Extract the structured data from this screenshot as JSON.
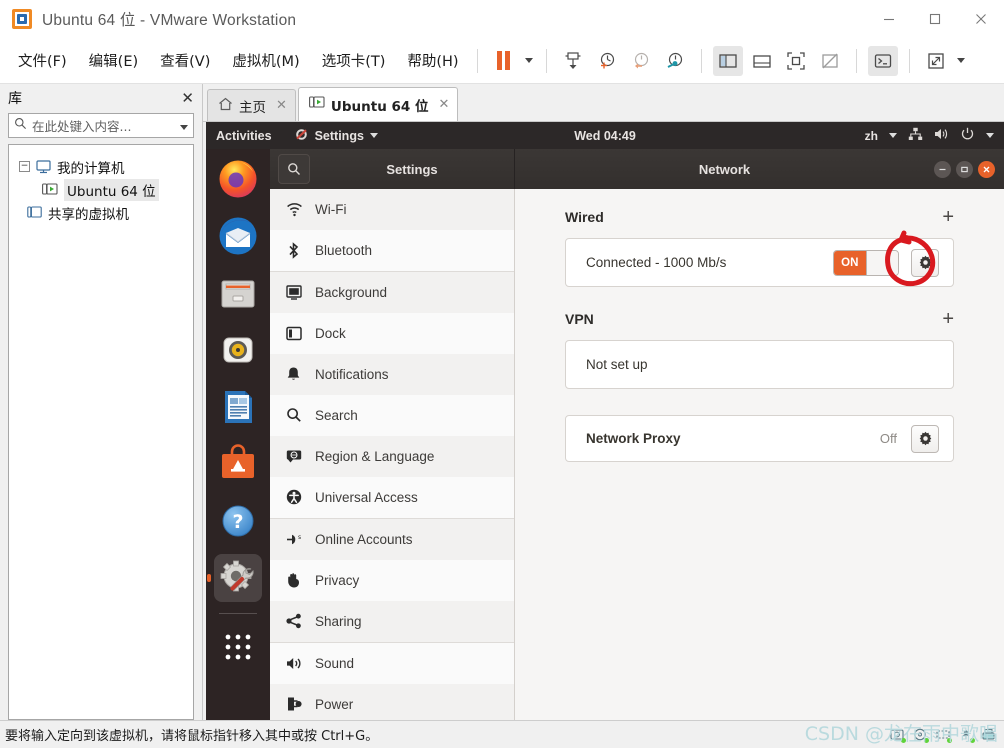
{
  "window": {
    "title": "Ubuntu 64 位 - VMware Workstation",
    "app_icon": "vmware-icon",
    "controls": {
      "minimize": "−",
      "maximize": "□",
      "close": "✕"
    }
  },
  "menubar": {
    "items": [
      "文件(F)",
      "编辑(E)",
      "查看(V)",
      "虚拟机(M)",
      "选项卡(T)",
      "帮助(H)"
    ],
    "toolbar": [
      {
        "name": "pause-button",
        "glyph": "pause"
      },
      {
        "name": "pause-dropdown-caret",
        "glyph": "caret"
      },
      {
        "name": "snapshot-manager-button",
        "glyph": "snapshot"
      },
      {
        "name": "take-snapshot-button",
        "glyph": "snap-add"
      },
      {
        "name": "revert-snapshot-button",
        "glyph": "snap-revert"
      },
      {
        "name": "manage-snapshots-button",
        "glyph": "snap-manage"
      },
      {
        "name": "show-library-button",
        "glyph": "panel-left"
      },
      {
        "name": "show-thumbnails-button",
        "glyph": "panel-bottom"
      },
      {
        "name": "fullscreen-button",
        "glyph": "fullscreen"
      },
      {
        "name": "unity-mode-button",
        "glyph": "unity"
      },
      {
        "name": "console-view-button",
        "glyph": "console"
      },
      {
        "name": "stretch-button",
        "glyph": "stretch"
      },
      {
        "name": "stretch-dropdown-caret",
        "glyph": "caret"
      }
    ]
  },
  "library": {
    "title": "库",
    "close_label": "✕",
    "search_placeholder": "在此处键入内容...",
    "tree": [
      {
        "label": "我的计算机",
        "level": 1,
        "expander": "−",
        "icon": "computer-icon"
      },
      {
        "label": "Ubuntu 64 位",
        "level": 2,
        "icon": "vm-running-icon",
        "selected": true
      },
      {
        "label": "共享的虚拟机",
        "level": 1,
        "icon": "shared-vms-icon"
      }
    ]
  },
  "tabs": [
    {
      "label": "主页",
      "icon": "home-icon",
      "active": false
    },
    {
      "label": "Ubuntu 64 位",
      "icon": "vm-running-icon",
      "active": true
    }
  ],
  "guest": {
    "topbar": {
      "activities": "Activities",
      "app_menu": "Settings",
      "app_menu_icon": "settings-app-icon",
      "clock": "Wed 04:49",
      "tray": {
        "keyboard": "zh",
        "network_icon": "wired-network-icon",
        "volume_icon": "volume-icon",
        "power_icon": "power-icon"
      }
    },
    "dock": [
      {
        "name": "firefox",
        "icon": "firefox-icon"
      },
      {
        "name": "thunderbird",
        "icon": "thunderbird-icon"
      },
      {
        "name": "files",
        "icon": "files-icon"
      },
      {
        "name": "rhythmbox",
        "icon": "rhythmbox-icon"
      },
      {
        "name": "libreoffice-writer",
        "icon": "libreoffice-writer-icon"
      },
      {
        "name": "ubuntu-software",
        "icon": "ubuntu-software-icon"
      },
      {
        "name": "help",
        "icon": "help-icon"
      },
      {
        "name": "settings",
        "icon": "settings-icon",
        "active": true
      },
      {
        "name": "show-applications",
        "icon": "app-grid-icon"
      }
    ],
    "settings_window": {
      "left_title": "Settings",
      "right_title": "Network",
      "search_icon": "search-icon",
      "window_buttons": {
        "minimize": "−",
        "maximize": "□",
        "close": "✕"
      },
      "sidebar": [
        {
          "label": "Wi-Fi",
          "icon": "wifi-icon"
        },
        {
          "label": "Bluetooth",
          "icon": "bluetooth-icon"
        },
        {
          "label": "Background",
          "icon": "background-icon"
        },
        {
          "label": "Dock",
          "icon": "dock-icon"
        },
        {
          "label": "Notifications",
          "icon": "bell-icon"
        },
        {
          "label": "Search",
          "icon": "search-icon"
        },
        {
          "label": "Region & Language",
          "icon": "region-language-icon"
        },
        {
          "label": "Universal Access",
          "icon": "universal-access-icon"
        },
        {
          "label": "Online Accounts",
          "icon": "online-accounts-icon"
        },
        {
          "label": "Privacy",
          "icon": "privacy-hand-icon"
        },
        {
          "label": "Sharing",
          "icon": "sharing-icon"
        },
        {
          "label": "Sound",
          "icon": "sound-icon"
        },
        {
          "label": "Power",
          "icon": "power-plug-icon"
        }
      ],
      "network": {
        "wired": {
          "heading": "Wired",
          "add_label": "+",
          "status": "Connected - 1000 Mb/s",
          "toggle_state": "ON",
          "settings_icon": "gear-icon"
        },
        "vpn": {
          "heading": "VPN",
          "add_label": "+",
          "status": "Not set up"
        },
        "proxy": {
          "label": "Network Proxy",
          "value": "Off",
          "settings_icon": "gear-icon"
        }
      }
    }
  },
  "statusbar": {
    "message": "要将输入定向到该虚拟机，请将鼠标指针移入其中或按 Ctrl+G。",
    "icons": [
      {
        "name": "hard-disk-status-icon"
      },
      {
        "name": "cd-dvd-status-icon"
      },
      {
        "name": "network-status-icon"
      },
      {
        "name": "usb-status-icon"
      },
      {
        "name": "printer-status-icon"
      }
    ]
  },
  "watermark": {
    "text": "CSDN @龙在雨中歌唱",
    "color": "#b8d9de"
  },
  "colors": {
    "accent_orange": "#e8622a",
    "gnome_dark": "#2c2828",
    "dock_dark": "#2d2424",
    "annotation_red": "#d9191f"
  }
}
